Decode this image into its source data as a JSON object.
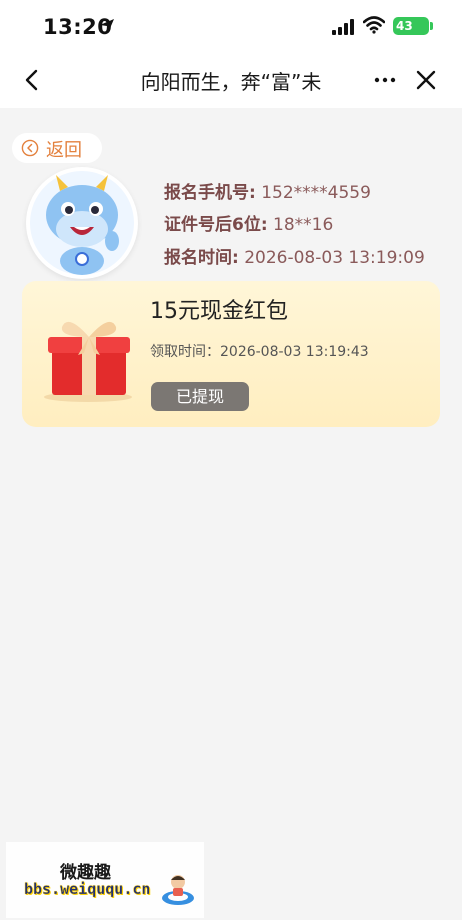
{
  "status_bar": {
    "time": "13:20",
    "battery": "43",
    "icons": [
      "location-arrow-icon",
      "signal-icon",
      "wifi-icon",
      "battery-icon"
    ]
  },
  "nav": {
    "title": "向阳而生，奔“富”未",
    "icons": [
      "back-chevron-icon",
      "more-icon",
      "close-icon"
    ]
  },
  "back_button": {
    "label": "返回",
    "icon": "circle-left-arrow-icon"
  },
  "info": {
    "phone_label": "报名手机号:",
    "phone_value": "152****4559",
    "id_label": "证件号后6位:",
    "id_value": "18**16",
    "time_label": "报名时间:",
    "time_value": "2026-08-03 13:19:09"
  },
  "reward_card": {
    "title": "15元现金红包",
    "claim_time": "领取时间：2026-08-03 13:19:43",
    "status_button": "已提现",
    "icon": "gift-box-icon"
  },
  "watermark": {
    "name": "微趣趣",
    "url": "bbs.weiququ.cn"
  },
  "colors": {
    "accent_orange": "#e3813e",
    "info_text": "#7a4a4a",
    "card_bg": "#fff3cf",
    "button_gray": "#7b7773",
    "battery_green": "#35c759"
  }
}
